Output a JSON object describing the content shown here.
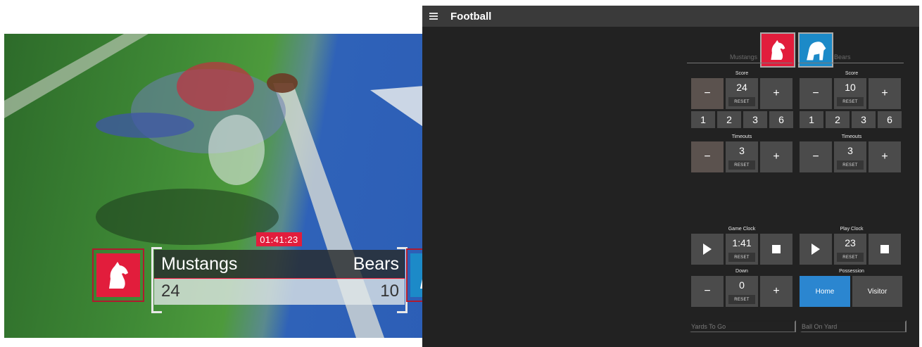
{
  "preview": {
    "game_time": "01:41:23",
    "home_name": "Mustangs",
    "visitor_name": "Bears",
    "home_score": "24",
    "visitor_score": "10"
  },
  "app": {
    "title": "Football",
    "home_label": "Mustangs",
    "visitor_label": "Bears",
    "score_label": "Score",
    "timeouts_label": "Timeouts",
    "minus": "−",
    "plus": "+",
    "reset": "RESET",
    "home_score": "24",
    "visitor_score": "10",
    "quick_points": [
      "1",
      "2",
      "3",
      "6"
    ],
    "home_timeouts": "3",
    "visitor_timeouts": "3",
    "game_clock_label": "Game Clock",
    "game_clock": "1:41",
    "play_clock_label": "Play Clock",
    "play_clock": "23",
    "down_label": "Down",
    "down": "0",
    "possession_label": "Possession",
    "possession_home": "Home",
    "possession_visitor": "Visitor",
    "yards_placeholder": "Yards To Go",
    "ball_placeholder": "Ball On Yard"
  },
  "colors": {
    "accent_red": "#e21d3c",
    "accent_blue": "#1c8ac8",
    "possession_active": "#2b86d0",
    "app_bg": "#222222"
  }
}
